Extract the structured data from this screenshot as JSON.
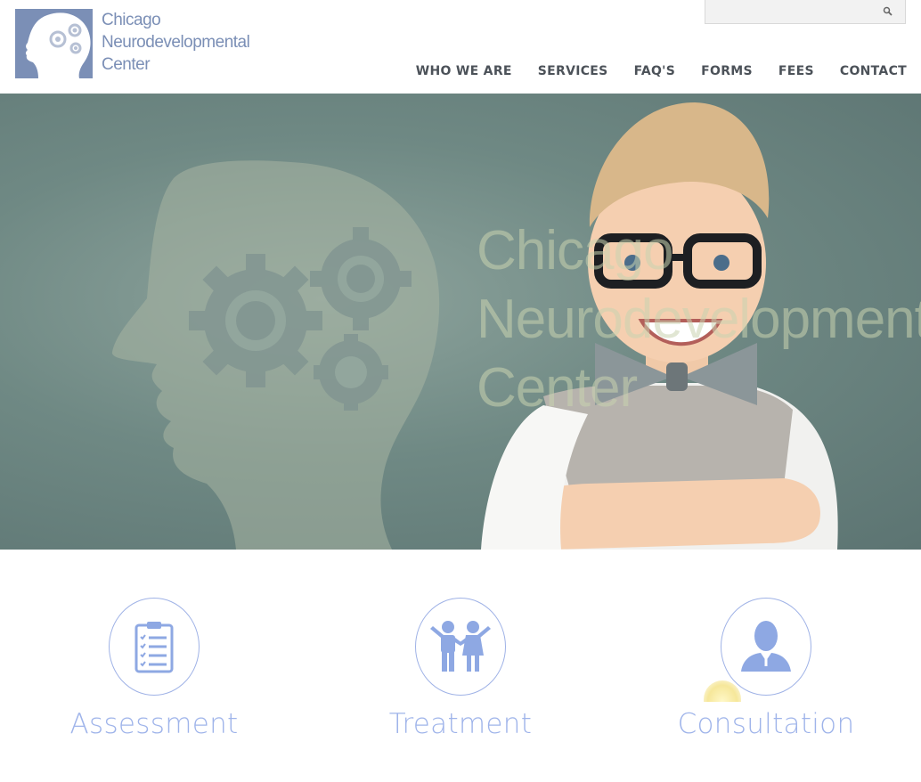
{
  "brand": {
    "line1": "Chicago",
    "line2": "Neurodevelopmental",
    "line3": "Center",
    "color": "#7b8fb6"
  },
  "search": {
    "placeholder": "",
    "value": "",
    "icon": "search-icon"
  },
  "nav": {
    "items": [
      {
        "label": "WHO WE ARE"
      },
      {
        "label": "SERVICES"
      },
      {
        "label": "FAQ'S"
      },
      {
        "label": "FORMS"
      },
      {
        "label": "FEES"
      },
      {
        "label": "CONTACT"
      }
    ]
  },
  "hero": {
    "title_line1": "Chicago",
    "title_line2": "Neurodevelopmental",
    "title_line3": "Center",
    "background_color": "#6f8984"
  },
  "services": [
    {
      "label": "Assessment",
      "icon": "clipboard-checklist-icon"
    },
    {
      "label": "Treatment",
      "icon": "children-icon"
    },
    {
      "label": "Consultation",
      "icon": "person-icon"
    }
  ],
  "colors": {
    "accent": "#9fb4ea",
    "nav_text": "#4c5259"
  }
}
